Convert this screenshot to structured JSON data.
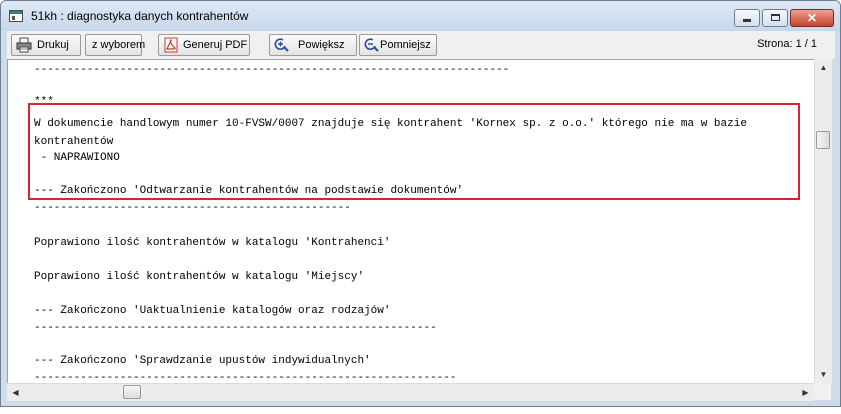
{
  "window": {
    "title": "51kh : diagnostyka danych kontrahentów"
  },
  "toolbar": {
    "print_label": "Drukuj",
    "print_selection_label": "z wyborem",
    "generate_pdf_label": "Generuj PDF",
    "zoom_in_label": "Powiększ",
    "zoom_out_label": "Pomniejsz",
    "page_indicator": "Strona: 1 / 1"
  },
  "report": {
    "lines": [
      "------------------------------------------------------------------------",
      "***",
      "W dokumencie handlowym numer 10-FVSW/0007 znajduje się kontrahent 'Kornex sp. z o.o.' którego nie ma w bazie",
      "kontrahentów",
      " - NAPRAWIONO",
      "--- Zakończono 'Odtwarzanie kontrahentów na podstawie dokumentów'",
      "------------------------------------------------",
      "Poprawiono ilość kontrahentów w katalogu 'Kontrahenci'",
      "Poprawiono ilość kontrahentów w katalogu 'Miejscy'",
      "--- Zakończono 'Uaktualnienie katalogów oraz rodzajów'",
      "-------------------------------------------------------------",
      "--- Zakończono 'Sprawdzanie upustów indywidualnych'",
      "----------------------------------------------------------------"
    ]
  },
  "colors": {
    "highlight_border": "#d8242f",
    "titlebar": "#c6d6ea"
  }
}
